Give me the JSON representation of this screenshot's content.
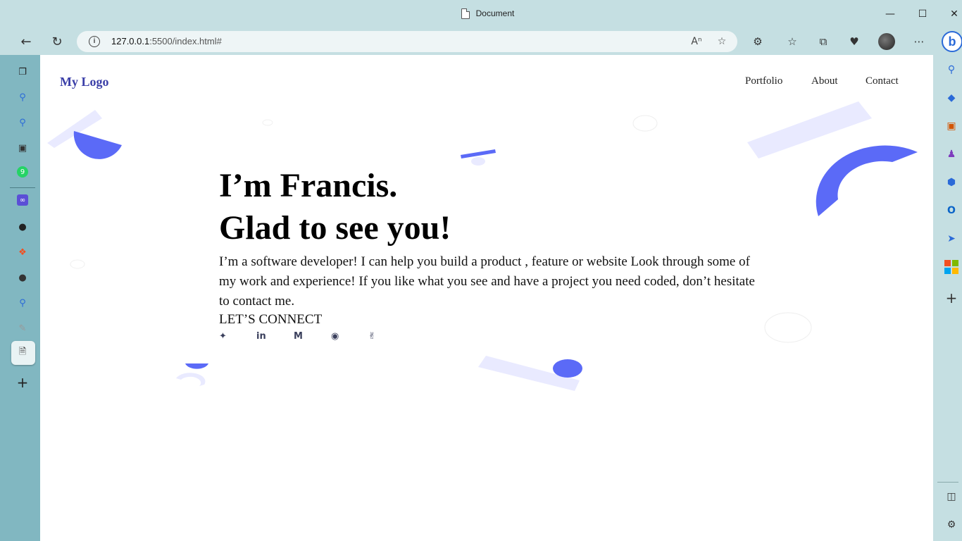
{
  "window": {
    "title": "Document"
  },
  "browser": {
    "url_host": "127.0.0.1",
    "url_rest": ":5500/index.html#"
  },
  "page": {
    "logo": "My Logo",
    "nav": [
      "Portfolio",
      "About",
      "Contact"
    ],
    "heading_line1": "I’m Francis.",
    "heading_line2": "Glad to see you!",
    "intro": "I’m a software developer! I can help you build a product , feature or website Look through some of my work and experience! If you like what you see and have a project you need coded, don’t hesitate to contact me.",
    "connect": "LET’S CONNECT",
    "social_icons": [
      "twitter-icon",
      "linkedin-icon",
      "medium-icon",
      "github-icon",
      "angellist-icon"
    ]
  },
  "colors": {
    "accent": "#5b6af7",
    "accent_light": "#e9eaff",
    "logo": "#3b3fa8",
    "chrome": "#c5dfe2",
    "left_sidebar": "#81b7c1"
  }
}
